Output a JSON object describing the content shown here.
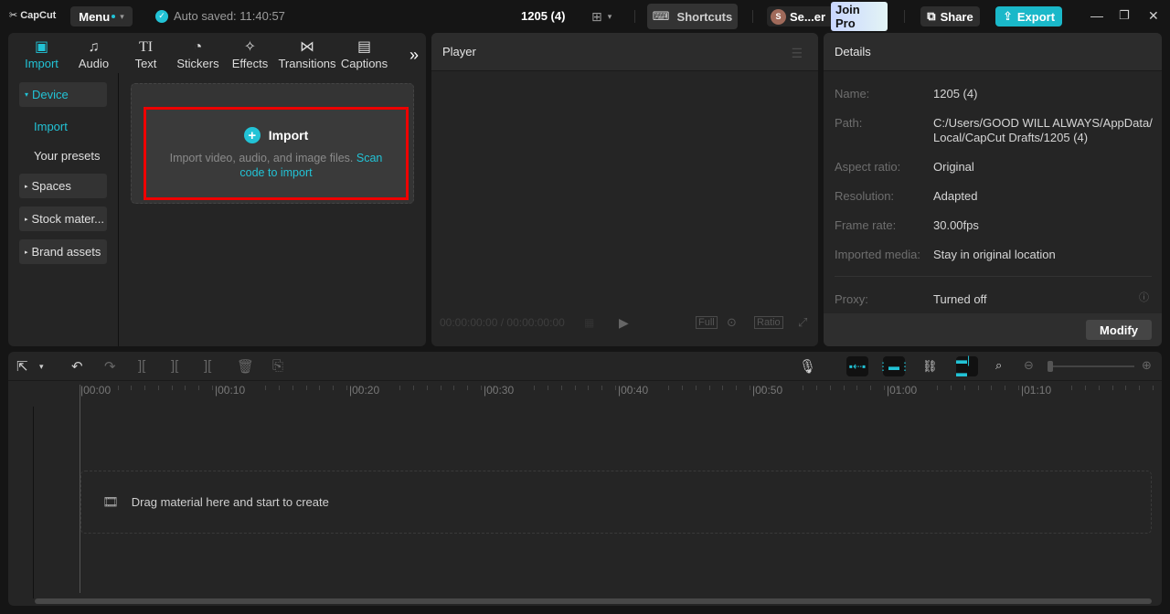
{
  "titlebar": {
    "app_name": "CapCut",
    "menu_label": "Menu",
    "autosave": "Auto saved: 11:40:57",
    "project_title": "1205 (4)",
    "shortcuts_label": "Shortcuts",
    "user_initial": "S",
    "user_name": "Se...er",
    "join_pro_label": "Join Pro",
    "share_label": "Share",
    "export_label": "Export",
    "accent_color": "#22c3d6"
  },
  "media_tabs": [
    {
      "label": "Import",
      "icon": "▣",
      "active": true
    },
    {
      "label": "Audio",
      "icon": "♫"
    },
    {
      "label": "Text",
      "icon": "TI"
    },
    {
      "label": "Stickers",
      "icon": "◔"
    },
    {
      "label": "Effects",
      "icon": "✧"
    },
    {
      "label": "Transitions",
      "icon": "⋈"
    },
    {
      "label": "Captions",
      "icon": "▤"
    }
  ],
  "more_label": "»",
  "sidebar": {
    "device": "Device",
    "import": "Import",
    "your_presets": "Your presets",
    "spaces": "Spaces",
    "stock": "Stock mater...",
    "brand": "Brand assets"
  },
  "import_box": {
    "title": "Import",
    "description": "Import video, audio, and image files.",
    "link": "Scan code to import"
  },
  "player": {
    "title": "Player",
    "timecode": "00:00:00:00 / 00:00:00:00",
    "full_label": "Full",
    "ratio_label": "Ratio"
  },
  "details": {
    "title": "Details",
    "rows": [
      {
        "label": "Name:",
        "value": "1205 (4)"
      },
      {
        "label": "Path:",
        "value": "C:/Users/GOOD WILL ALWAYS/AppData/ Local/CapCut Drafts/1205 (4)"
      },
      {
        "label": "Aspect ratio:",
        "value": "Original"
      },
      {
        "label": "Resolution:",
        "value": "Adapted"
      },
      {
        "label": "Frame rate:",
        "value": "30.00fps"
      },
      {
        "label": "Imported media:",
        "value": "Stay in original location"
      },
      {
        "label": "Proxy:",
        "value": "Turned off"
      }
    ],
    "modify_label": "Modify"
  },
  "timeline": {
    "ruler_labels": [
      "00:00",
      "00:10",
      "00:20",
      "00:30",
      "00:40",
      "00:50",
      "01:00",
      "01:10"
    ],
    "drop_hint": "Drag material here and start to create"
  }
}
